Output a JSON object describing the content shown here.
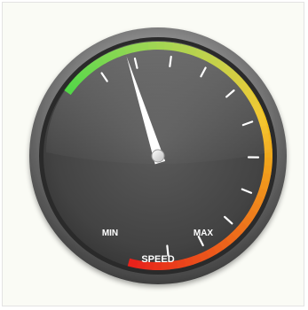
{
  "gauge": {
    "min_label": "MIN",
    "max_label": "MAX",
    "title": "SPEED",
    "level_fraction": 0.15,
    "colors": {
      "low": "#39d12b",
      "mid": "#f3c21c",
      "high": "#e8221b",
      "face": "#4a4a4a",
      "bezel": "#7b7b7b",
      "needle": "#ffffff"
    }
  }
}
